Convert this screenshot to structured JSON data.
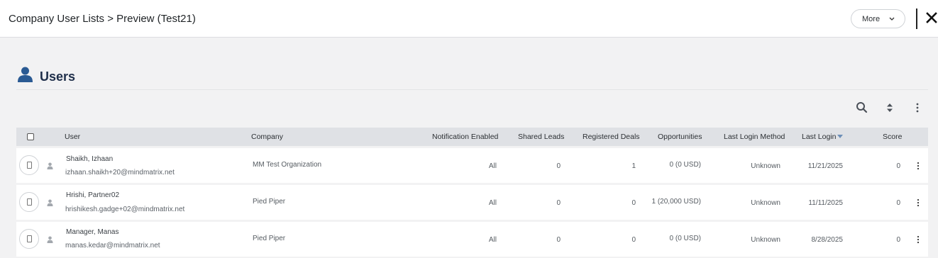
{
  "header": {
    "title": "Company User Lists > Preview (Test21)",
    "more_label": "More"
  },
  "section": {
    "title": "Users"
  },
  "toolbar": {
    "icons": [
      "search-icon",
      "sort-icon",
      "kebab-menu-icon"
    ]
  },
  "table": {
    "columns": {
      "user": "User",
      "company": "Company",
      "notification": "Notification Enabled",
      "shared_leads": "Shared Leads",
      "registered_deals": "Registered Deals",
      "opportunities": "Opportunities",
      "last_login_method": "Last Login Method",
      "last_login": "Last Login",
      "score": "Score"
    },
    "sorted_column": "Last Login",
    "rows": [
      {
        "name": "Shaikh, Izhaan",
        "email": "izhaan.shaikh+20@mindmatrix.net",
        "company": "MM Test Organization",
        "notification": "All",
        "shared_leads": "0",
        "registered_deals": "1",
        "opportunities": "0 (0 USD)",
        "last_login_method": "Unknown",
        "last_login": "11/21/2025",
        "score": "0"
      },
      {
        "name": "Hrishi, Partner02",
        "email": "hrishikesh.gadge+02@mindmatrix.net",
        "company": "Pied Piper",
        "notification": "All",
        "shared_leads": "0",
        "registered_deals": "0",
        "opportunities": "1 (20,000 USD)",
        "last_login_method": "Unknown",
        "last_login": "11/11/2025",
        "score": "0"
      },
      {
        "name": "Manager, Manas",
        "email": "manas.kedar@mindmatrix.net",
        "company": "Pied Piper",
        "notification": "All",
        "shared_leads": "0",
        "registered_deals": "0",
        "opportunities": "0 (0 USD)",
        "last_login_method": "Unknown",
        "last_login": "8/28/2025",
        "score": "0"
      }
    ]
  },
  "colors": {
    "accent_blue": "#2a5a93",
    "header_bg": "#dfe1e5",
    "page_bg": "#f2f2f3"
  }
}
